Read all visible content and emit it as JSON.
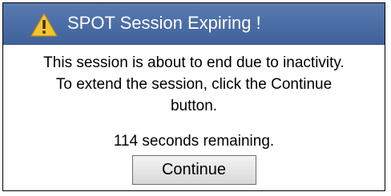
{
  "dialog": {
    "title": "SPOT Session Expiring !",
    "title_icon": "warning-triangle-icon",
    "colors": {
      "titlebar": "#4d6fa8",
      "icon_fill": "#f3c433",
      "title_text": "#ffffff"
    },
    "message_lines": [
      "This session is about to end due to inactivity.",
      "To extend the session, click the Continue",
      "button."
    ],
    "seconds_remaining": "114",
    "remaining_suffix": "seconds remaining.",
    "continue_label": "Continue"
  }
}
